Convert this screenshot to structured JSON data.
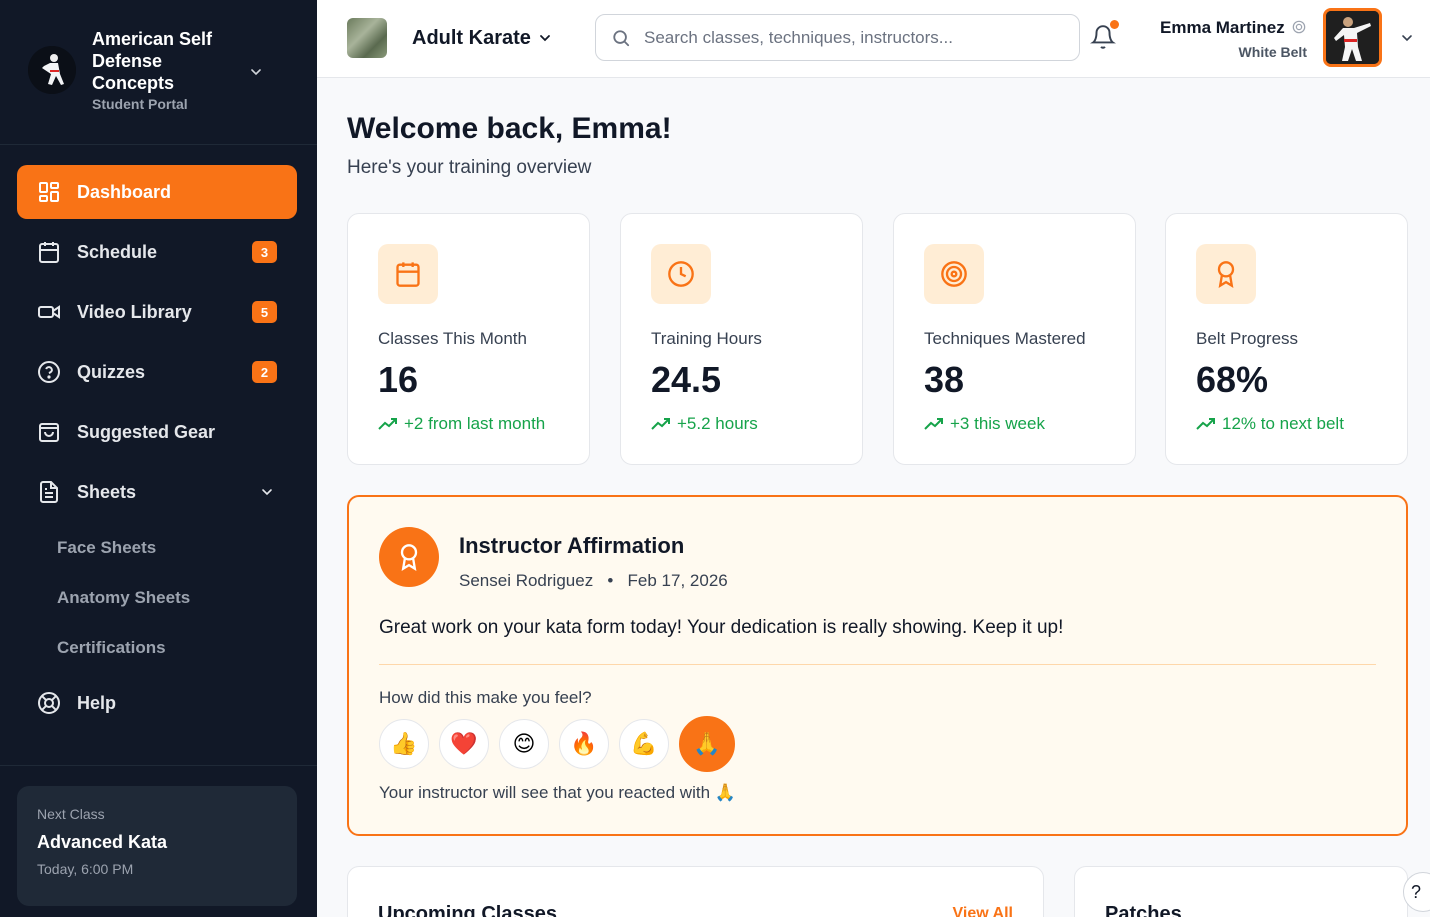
{
  "brand": {
    "name": "American Self Defense Concepts",
    "subtitle": "Student Portal"
  },
  "sidebar": {
    "items": [
      {
        "label": "Dashboard",
        "icon": "dashboard-icon",
        "active": true
      },
      {
        "label": "Schedule",
        "icon": "calendar-icon",
        "badge": "3"
      },
      {
        "label": "Video Library",
        "icon": "video-icon",
        "badge": "5"
      },
      {
        "label": "Quizzes",
        "icon": "help-circle-icon",
        "badge": "2"
      },
      {
        "label": "Suggested Gear",
        "icon": "shopping-bag-icon"
      },
      {
        "label": "Sheets",
        "icon": "document-icon",
        "expanded": true
      },
      {
        "label": "Help",
        "icon": "lifebuoy-icon"
      }
    ],
    "sheets_sub": [
      "Face Sheets",
      "Anatomy Sheets",
      "Certifications"
    ],
    "next_class": {
      "label": "Next Class",
      "title": "Advanced Kata",
      "time": "Today, 6:00 PM"
    }
  },
  "header": {
    "class_name": "Adult Karate",
    "search_placeholder": "Search classes, techniques, instructors...",
    "user_name": "Emma Martinez",
    "user_belt": "White Belt"
  },
  "main": {
    "welcome": "Welcome back, Emma!",
    "subtitle": "Here's your training overview",
    "stats": [
      {
        "label": "Classes This Month",
        "value": "16",
        "change": "+2 from last month",
        "icon": "calendar-icon"
      },
      {
        "label": "Training Hours",
        "value": "24.5",
        "change": "+5.2 hours",
        "icon": "clock-icon"
      },
      {
        "label": "Techniques Mastered",
        "value": "38",
        "change": "+3 this week",
        "icon": "target-icon"
      },
      {
        "label": "Belt Progress",
        "value": "68%",
        "change": "12% to next belt",
        "icon": "award-icon"
      }
    ],
    "affirmation": {
      "title": "Instructor Affirmation",
      "instructor": "Sensei Rodriguez",
      "date": "Feb 17, 2026",
      "message": "Great work on your kata form today! Your dedication is really showing. Keep it up!",
      "question": "How did this make you feel?",
      "reactions": [
        "👍",
        "❤️",
        "😊",
        "🔥",
        "💪",
        "🙏"
      ],
      "selected_reaction": "🙏",
      "feedback": "Your instructor will see that you reacted with"
    },
    "upcoming": {
      "title": "Upcoming Classes",
      "view_all": "View All"
    },
    "patches": {
      "title": "Patches"
    }
  },
  "colors": {
    "accent": "#f97316",
    "sidebar_bg": "#111827",
    "positive": "#16a34a"
  },
  "help_fab": "?"
}
